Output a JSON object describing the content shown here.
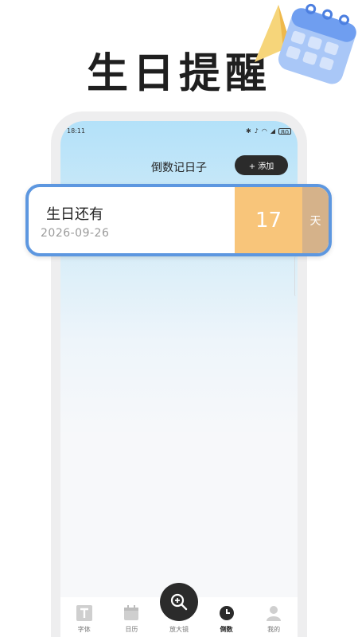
{
  "promo": {
    "title": "生日提醒"
  },
  "status_bar": {
    "time": "18:11",
    "battery": "80"
  },
  "header": {
    "title": "倒数记日子",
    "add_button": "+ 添加"
  },
  "countdown_items": [
    {
      "title": "生日还有",
      "date": "2026-09-26",
      "days": "17",
      "unit": "天"
    }
  ],
  "tab_bar": {
    "tabs": [
      {
        "label": "字体",
        "icon": "font-icon"
      },
      {
        "label": "日历",
        "icon": "calendar-icon"
      },
      {
        "label": "放大镜",
        "icon": "magnifier-icon"
      },
      {
        "label": "倒数",
        "icon": "clock-icon",
        "active": true
      },
      {
        "label": "我的",
        "icon": "user-icon"
      }
    ]
  },
  "colors": {
    "card_border": "#5d97e0",
    "days_bg": "#f8c57a",
    "unit_bg": "#d5b28a",
    "dark_button": "#2b2b2b"
  }
}
